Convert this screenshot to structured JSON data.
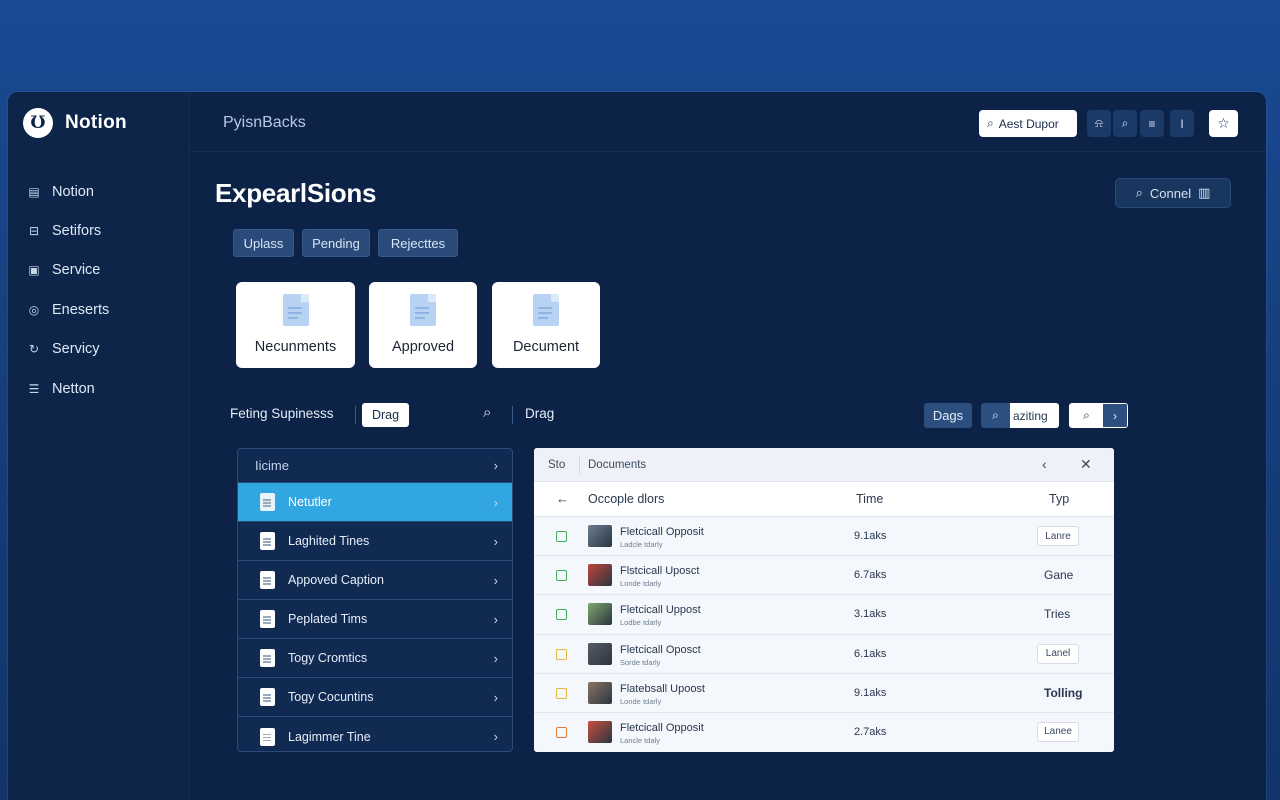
{
  "app": {
    "name": "Notion",
    "logo_glyph": "Ʊ"
  },
  "sidebar": {
    "items": [
      {
        "label": "Notion",
        "icon": "calendar-icon",
        "glyph": "▤"
      },
      {
        "label": "Setifors",
        "icon": "lock-icon",
        "glyph": "⊟"
      },
      {
        "label": "Service",
        "icon": "image-icon",
        "glyph": "▣"
      },
      {
        "label": "Eneserts",
        "icon": "globe-icon",
        "glyph": "◎"
      },
      {
        "label": "Servicy",
        "icon": "refresh-icon",
        "glyph": "↻"
      },
      {
        "label": "Netton",
        "icon": "document-icon",
        "glyph": "☰"
      }
    ]
  },
  "topbar": {
    "breadcrumb": "PyisnBacks",
    "search_label": "Aest Dupor",
    "buttons": [
      {
        "icon": "bell-icon",
        "glyph": "⍾"
      },
      {
        "icon": "search-icon",
        "glyph": "⌕"
      },
      {
        "icon": "menu-icon",
        "glyph": "≡"
      },
      {
        "icon": "text-cursor-icon",
        "glyph": "I"
      }
    ],
    "star_glyph": "☆"
  },
  "main": {
    "title": "ExpearlSions",
    "connect_label": "Connel",
    "chips": [
      "Uplass",
      "Pending",
      "Rejecttes"
    ],
    "cards": [
      "Necunments",
      "Approved",
      "Decument"
    ],
    "toolbar": {
      "label": "Feting Supinesss",
      "drag_pill": "Drag",
      "drag2": "Drag",
      "dags_label": "Dags",
      "search_text": "aziting"
    }
  },
  "list": {
    "header": "Iicime",
    "items": [
      {
        "label": "Netutler",
        "active": true
      },
      {
        "label": "Laghited Tines",
        "active": false
      },
      {
        "label": "Appoved Caption",
        "active": false
      },
      {
        "label": "Peplated Tims",
        "active": false
      },
      {
        "label": "Togy Cromtics",
        "active": false
      },
      {
        "label": "Togy Cocuntins",
        "active": false
      },
      {
        "label": "Lagimmer Tine",
        "active": false
      }
    ]
  },
  "table": {
    "top_left": "Sto",
    "top_title": "Documents",
    "columns": {
      "name": "Occople dlors",
      "time": "Time",
      "type": "Typ"
    },
    "rows": [
      {
        "title": "Fletcicall Opposit",
        "sub": "Ladcle tdarly",
        "size": "9.1aks",
        "type": "Lanre",
        "pill": true,
        "bold": false,
        "check_color": "#3fae5a",
        "thumb_color": "#6a7f92"
      },
      {
        "title": "Flstcicall Uposct",
        "sub": "Londe tdarly",
        "size": "6.7aks",
        "type": "Gane",
        "pill": false,
        "bold": false,
        "check_color": "#3fae5a",
        "thumb_color": "#c0463a"
      },
      {
        "title": "Fletcicall Uppost",
        "sub": "Lodbe tdarly",
        "size": "3.1aks",
        "type": "Tries",
        "pill": false,
        "bold": false,
        "check_color": "#3fae5a",
        "thumb_color": "#7fa86c"
      },
      {
        "title": "Fletcicall Oposct",
        "sub": "Sorde tdarly",
        "size": "6.1aks",
        "type": "Lanel",
        "pill": true,
        "bold": false,
        "check_color": "#e6b83a",
        "thumb_color": "#555c64"
      },
      {
        "title": "Flatebsall Upoost",
        "sub": "Londe tdarly",
        "size": "9.1aks",
        "type": "Tolling",
        "pill": false,
        "bold": true,
        "check_color": "#e6b83a",
        "thumb_color": "#8a7464"
      },
      {
        "title": "Fletcicall Opposit",
        "sub": "Lancle tdaly",
        "size": "2.7aks",
        "type": "Lanee",
        "pill": true,
        "bold": false,
        "check_color": "#e0793c",
        "thumb_color": "#c8503e"
      }
    ]
  }
}
